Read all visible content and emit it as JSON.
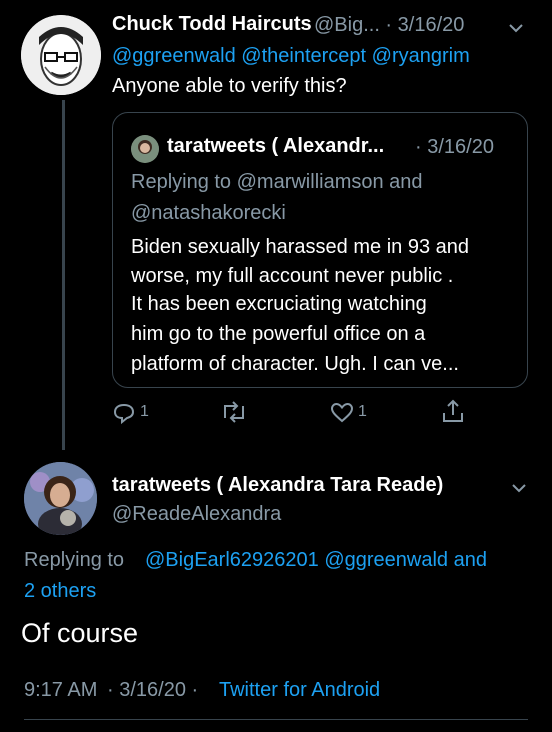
{
  "first_tweet": {
    "author_name": "Chuck Todd Haircuts",
    "author_handle_date": "@Big... · 3/16/20",
    "mentions": "@ggreenwald @theintercept @ryangrim",
    "text": "Anyone able to verify this?"
  },
  "quoted_tweet": {
    "author": "taratweets ( Alexandr...",
    "date": "· 3/16/20",
    "replying_line1": "Replying to @marwilliamson and",
    "replying_line2": "@natashakorecki",
    "body_lines": [
      "Biden sexually harassed me in 93 and",
      "worse, my full account never public .",
      "It has been excruciating watching",
      "him go to the powerful office on a",
      "platform of character. Ugh. I can ve..."
    ]
  },
  "actions": {
    "reply_count": "1",
    "like_count": "1"
  },
  "main_tweet": {
    "author_name": "taratweets ( Alexandra Tara Reade)",
    "handle": "@ReadeAlexandra",
    "replying_prefix": "Replying to",
    "replying_mentions": "@BigEarl62926201 @ggreenwald and",
    "replying_others": "2 others",
    "text": "Of course",
    "time": "9:17 AM",
    "date": "· 3/16/20 ·",
    "source": "Twitter for Android"
  },
  "colors": {
    "background": "#000000",
    "muted": "#8899a6",
    "link": "#1da1f2",
    "border": "#38444d"
  }
}
